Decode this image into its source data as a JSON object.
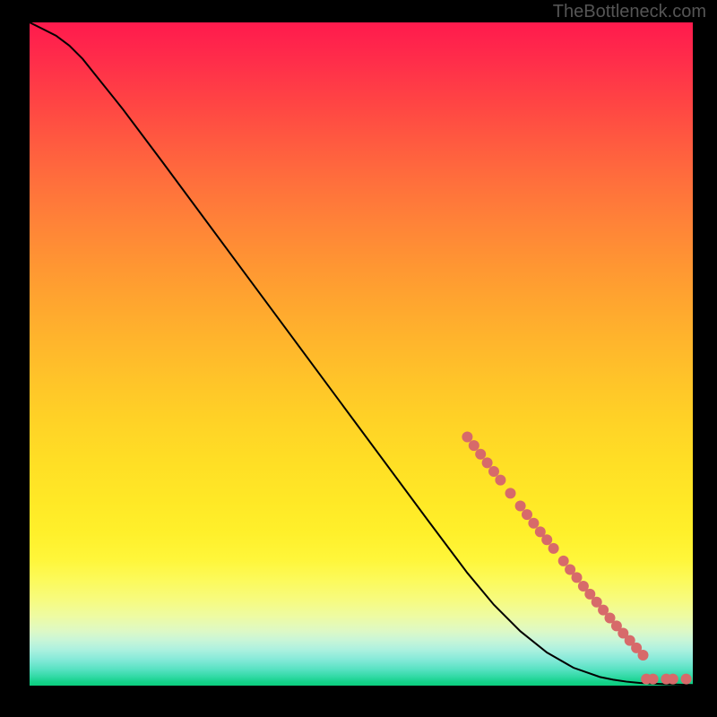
{
  "watermark": "TheBottleneck.com",
  "chart_data": {
    "type": "line",
    "title": "",
    "xlabel": "",
    "ylabel": "",
    "xlim": [
      0,
      100
    ],
    "ylim": [
      0,
      100
    ],
    "grid": false,
    "legend": false,
    "curve": {
      "name": "bottleneck-curve",
      "color": "#000000",
      "x": [
        0,
        2,
        4,
        6,
        8,
        10,
        14,
        20,
        30,
        40,
        50,
        60,
        66,
        70,
        74,
        78,
        82,
        86,
        88,
        90,
        92,
        94,
        96,
        98,
        100
      ],
      "y": [
        100,
        99,
        98,
        96.5,
        94.5,
        92,
        87,
        79,
        65.5,
        52,
        38.5,
        25,
        17,
        12.2,
        8.2,
        5,
        2.7,
        1.3,
        0.9,
        0.6,
        0.4,
        0.3,
        0.2,
        0.15,
        0.1
      ]
    },
    "markers": {
      "name": "highlight-dots",
      "color": "#d76a6a",
      "radius_px": 6,
      "points": [
        {
          "x": 66.0,
          "y": 37.5
        },
        {
          "x": 67.0,
          "y": 36.2
        },
        {
          "x": 68.0,
          "y": 34.9
        },
        {
          "x": 69.0,
          "y": 33.6
        },
        {
          "x": 70.0,
          "y": 32.3
        },
        {
          "x": 71.0,
          "y": 31.0
        },
        {
          "x": 72.5,
          "y": 29.0
        },
        {
          "x": 74.0,
          "y": 27.1
        },
        {
          "x": 75.0,
          "y": 25.8
        },
        {
          "x": 76.0,
          "y": 24.5
        },
        {
          "x": 77.0,
          "y": 23.2
        },
        {
          "x": 78.0,
          "y": 22.0
        },
        {
          "x": 79.0,
          "y": 20.7
        },
        {
          "x": 80.5,
          "y": 18.8
        },
        {
          "x": 81.5,
          "y": 17.5
        },
        {
          "x": 82.5,
          "y": 16.3
        },
        {
          "x": 83.5,
          "y": 15.0
        },
        {
          "x": 84.5,
          "y": 13.8
        },
        {
          "x": 85.5,
          "y": 12.6
        },
        {
          "x": 86.5,
          "y": 11.4
        },
        {
          "x": 87.5,
          "y": 10.2
        },
        {
          "x": 88.5,
          "y": 9.0
        },
        {
          "x": 89.5,
          "y": 7.9
        },
        {
          "x": 90.5,
          "y": 6.8
        },
        {
          "x": 91.5,
          "y": 5.7
        },
        {
          "x": 92.5,
          "y": 4.6
        },
        {
          "x": 93.0,
          "y": 1.0
        },
        {
          "x": 94.0,
          "y": 1.0
        },
        {
          "x": 96.0,
          "y": 1.0
        },
        {
          "x": 97.0,
          "y": 1.0
        },
        {
          "x": 99.0,
          "y": 1.0
        }
      ]
    }
  }
}
